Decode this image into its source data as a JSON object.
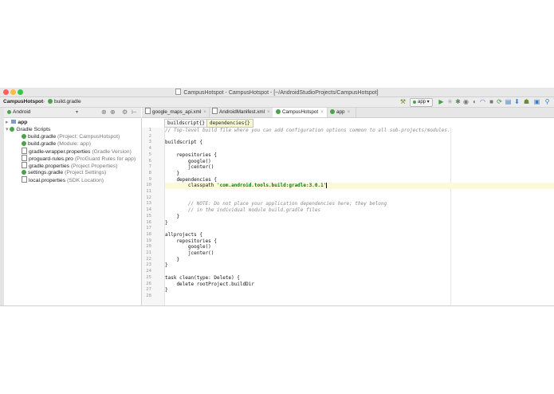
{
  "window": {
    "title": "CampusHotspot - CampusHotspot - [~/AndroidStudioProjects/CampusHotspot]"
  },
  "navbar": {
    "crumbs": [
      "CampusHotspot",
      "build.gradle"
    ],
    "run_config": "app"
  },
  "project_panel": {
    "view_mode": "Android",
    "tree": [
      {
        "name": "app",
        "detail": ""
      },
      {
        "name": "Gradle Scripts",
        "detail": ""
      },
      {
        "name": "build.gradle",
        "detail": "(Project: CampusHotspot)"
      },
      {
        "name": "build.gradle",
        "detail": "(Module: app)"
      },
      {
        "name": "gradle-wrapper.properties",
        "detail": "(Gradle Version)"
      },
      {
        "name": "proguard-rules.pro",
        "detail": "(ProGuard Rules for app)"
      },
      {
        "name": "gradle.properties",
        "detail": "(Project Properties)"
      },
      {
        "name": "settings.gradle",
        "detail": "(Project Settings)"
      },
      {
        "name": "local.properties",
        "detail": "(SDK Location)"
      }
    ]
  },
  "editor": {
    "tabs": [
      {
        "label": "google_maps_api.xml"
      },
      {
        "label": "AndroidManifest.xml"
      },
      {
        "label": "CampusHotspot"
      },
      {
        "label": "app"
      }
    ],
    "breadcrumb": [
      "buildscript{}",
      "dependencies{}"
    ],
    "line_numbers": [
      "1",
      "2",
      "3",
      "4",
      "5",
      "6",
      "7",
      "8",
      "9",
      "10",
      "11",
      "12",
      "13",
      "14",
      "15",
      "16",
      "17",
      "18",
      "19",
      "20",
      "21",
      "22",
      "23",
      "24",
      "25",
      "26",
      "27",
      "28"
    ],
    "code": {
      "l1": "// Top-level build file where you can add configuration options common to all sub-projects/modules.",
      "l2": "",
      "l3": "buildscript {",
      "l4": "",
      "l5": "    repositories {",
      "l6": "        google()",
      "l7": "        jcenter()",
      "l8": "    }",
      "l9": "    dependencies {",
      "l10_pre": "        classpath ",
      "l10_str": "'com.android.tools.build:gradle:3.0.1'",
      "l11": "",
      "l12": "",
      "l13": "        // NOTE: Do not place your application dependencies here; they belong",
      "l14": "        // in the individual module build.gradle files",
      "l15": "    }",
      "l16": "}",
      "l17": "",
      "l18": "allprojects {",
      "l19": "    repositories {",
      "l20": "        google()",
      "l21": "        jcenter()",
      "l22": "    }",
      "l23": "}",
      "l24": "",
      "l25": "task clean(type: Delete) {",
      "l26": "    delete rootProject.buildDir",
      "l27": "}",
      "l28": ""
    }
  },
  "colors": {
    "accent_green": "#4aa34a",
    "current_line": "#fcfbd9",
    "comment": "#888888",
    "string": "#067d17"
  }
}
